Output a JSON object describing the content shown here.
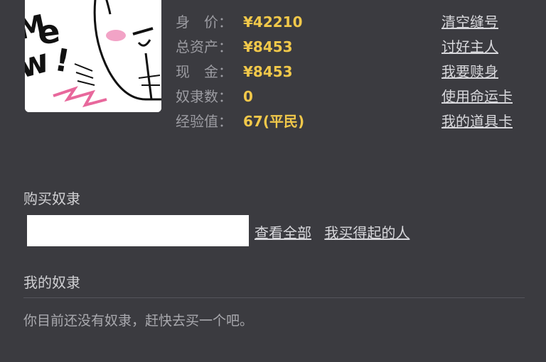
{
  "avatar": {
    "text": "Mew!"
  },
  "stats": [
    {
      "label": "身　价：",
      "value": "¥42210"
    },
    {
      "label": "总资产：",
      "value": "¥8453"
    },
    {
      "label": "现　金：",
      "value": "¥8453"
    },
    {
      "label": "奴隶数：",
      "value": "0"
    },
    {
      "label": "经验值：",
      "value": "67(平民)"
    }
  ],
  "actions": [
    {
      "label": "清空缝号"
    },
    {
      "label": "讨好主人"
    },
    {
      "label": "我要赎身"
    },
    {
      "label": "使用命运卡"
    },
    {
      "label": "我的道具卡"
    }
  ],
  "buy": {
    "title": "购买奴隶",
    "input_value": "",
    "view_all": "查看全部",
    "affordable": "我买得起的人"
  },
  "my_slaves": {
    "title": "我的奴隶",
    "empty_message": "你目前还没有奴隶，赶快去买一个吧。"
  },
  "colors": {
    "background": "#3b3b40",
    "value_accent": "#f1c84a",
    "label": "#9c9ca2",
    "link": "#d8d8dc"
  }
}
